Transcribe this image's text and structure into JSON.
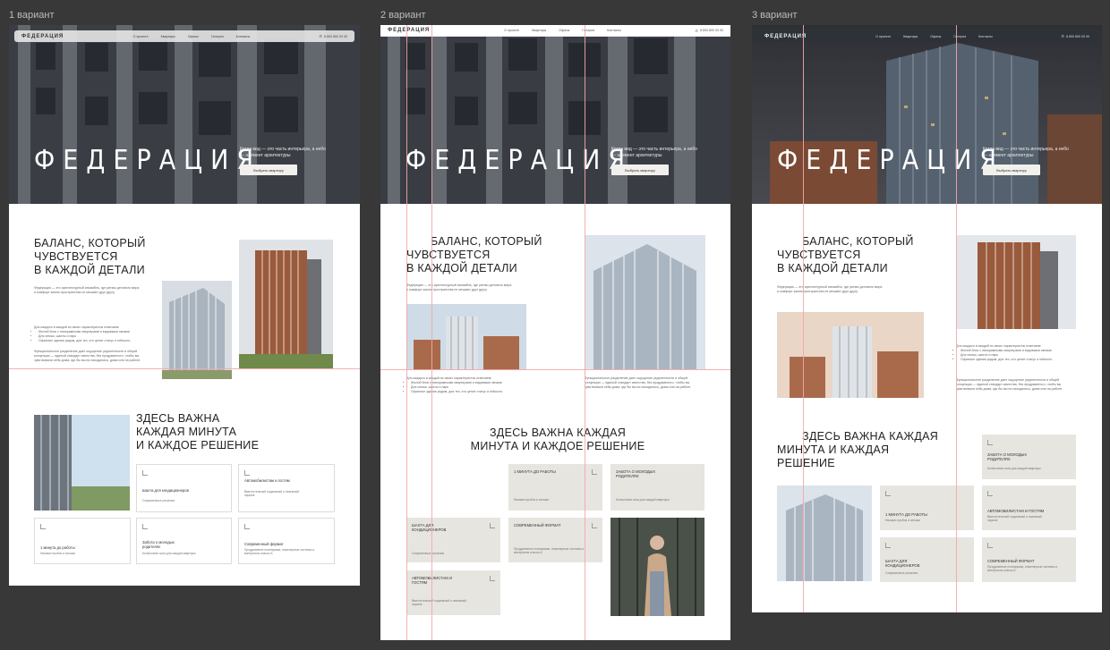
{
  "labels": [
    "1 вариант",
    "2 вариант",
    "3 вариант"
  ],
  "nav": {
    "logo": "ФЕДЕРАЦИЯ",
    "items": [
      "О проекте",
      "Квартиры",
      "Офисы",
      "Галерея",
      "Контакты"
    ],
    "phone": "8 800 800 00 00"
  },
  "hero": {
    "title": "ФЕДЕРАЦИЯ",
    "subtitle": "Когда вид — это часть интерьера, а небо — элемент архитектуры",
    "button": "Выбрать квартиру"
  },
  "about": {
    "title_lines": [
      "БАЛАНС, КОТОРЫЙ",
      "ЧУВСТВУЕТСЯ",
      "В КАЖДОЙ ДЕТАЛИ"
    ],
    "intro": "Федерация — это архитектурный ансамбль, где ритмы делового мира и комфорт жизни пространства не мешают друг другу",
    "list_title": "Для каждого в каждой из своих характеристик отмечаем:",
    "list": [
      "Жилой блок с панорамными квартирами и видовыми окнами",
      "Для семьи, шахты и парк",
      "Офисные здания рядом, для тех, кто ценит статус и гибкость"
    ],
    "closing": "Функциональное разделение дает ощущение уединенности и общей концепции — единый стандарт качества, без продуманного, чтобы вы чувствовали себя дома, где бы вы ни находились, дома или на работе."
  },
  "features": {
    "title_lines": [
      "ЗДЕСЬ ВАЖНА",
      "КАЖДАЯ МИНУТА",
      "И КАЖДОЕ РЕШЕНИЕ"
    ],
    "title_lines_v2": [
      "ЗДЕСЬ ВАЖНА КАЖДАЯ",
      "МИНУТА И КАЖДОЕ РЕШЕНИЕ"
    ],
    "title_lines_v3": [
      "ЗДЕСЬ ВАЖНА КАЖДАЯ",
      "МИНУТА И КАЖДАЯ",
      "РЕШЕНИЕ"
    ],
    "cards": [
      {
        "title": "Шахта для кондиционеров",
        "text": "Современные решения"
      },
      {
        "title": "Автомобилистам и гостям",
        "text": "Вместительный подземный и наземный паркинг"
      },
      {
        "title": "1 минута до работы",
        "text": "Никаких пробок и спешки"
      },
      {
        "title": "Забота о молодых родителях",
        "text": "Колясочная зона для каждой квартиры"
      },
      {
        "title": "Современный формат",
        "text": "Продуманные планировки, инженерные системы и материалы класса А"
      }
    ],
    "cards_v2": [
      {
        "title": "1 МИНУТА ДО РАБОТЫ",
        "text": "Никаких пробок и спешки"
      },
      {
        "title": "ЗАБОТА О МОЛОДЫХ РОДИТЕЛЯХ",
        "text": "Колясочная зона для каждой квартиры"
      },
      {
        "title": "ШАХТА ДЛЯ КОНДИЦИОНЕРОВ",
        "text": "Современные решения"
      },
      {
        "title": "СОВРЕМЕННЫЙ ФОРМАТ",
        "text": "Продуманные планировки, инженерные системы и материалы класса А"
      },
      {
        "title": "АВТОМОБИЛИСТАМ И ГОСТЯМ",
        "text": "Вместительный подземный и наземный паркинг"
      }
    ],
    "cards_v3": [
      {
        "title": "ЗАБОТА О МОЛОДЫХ РОДИТЕЛЯХ",
        "text": "Колясочная зона для каждой квартиры"
      },
      {
        "title": "1 МИНУТА ДО РАБОТЫ",
        "text": "Никаких пробок и спешки"
      },
      {
        "title": "АВТОМОБИЛИСТАМ И ГОСТЯМ",
        "text": "Вместительный подземный и наземный паркинг"
      },
      {
        "title": "ШАХТА ДЛЯ КОНДИЦИОНЕРОВ",
        "text": "Современные решения"
      },
      {
        "title": "СОВРЕМЕННЫЙ ФОРМАТ",
        "text": "Продуманные планировки, инженерные системы и материалы класса А"
      }
    ]
  },
  "colors": {
    "canvas": "#383838",
    "beige_card": "#e7e5e0",
    "guide": "#f3a8a8",
    "brick": "#9a5a3c"
  }
}
